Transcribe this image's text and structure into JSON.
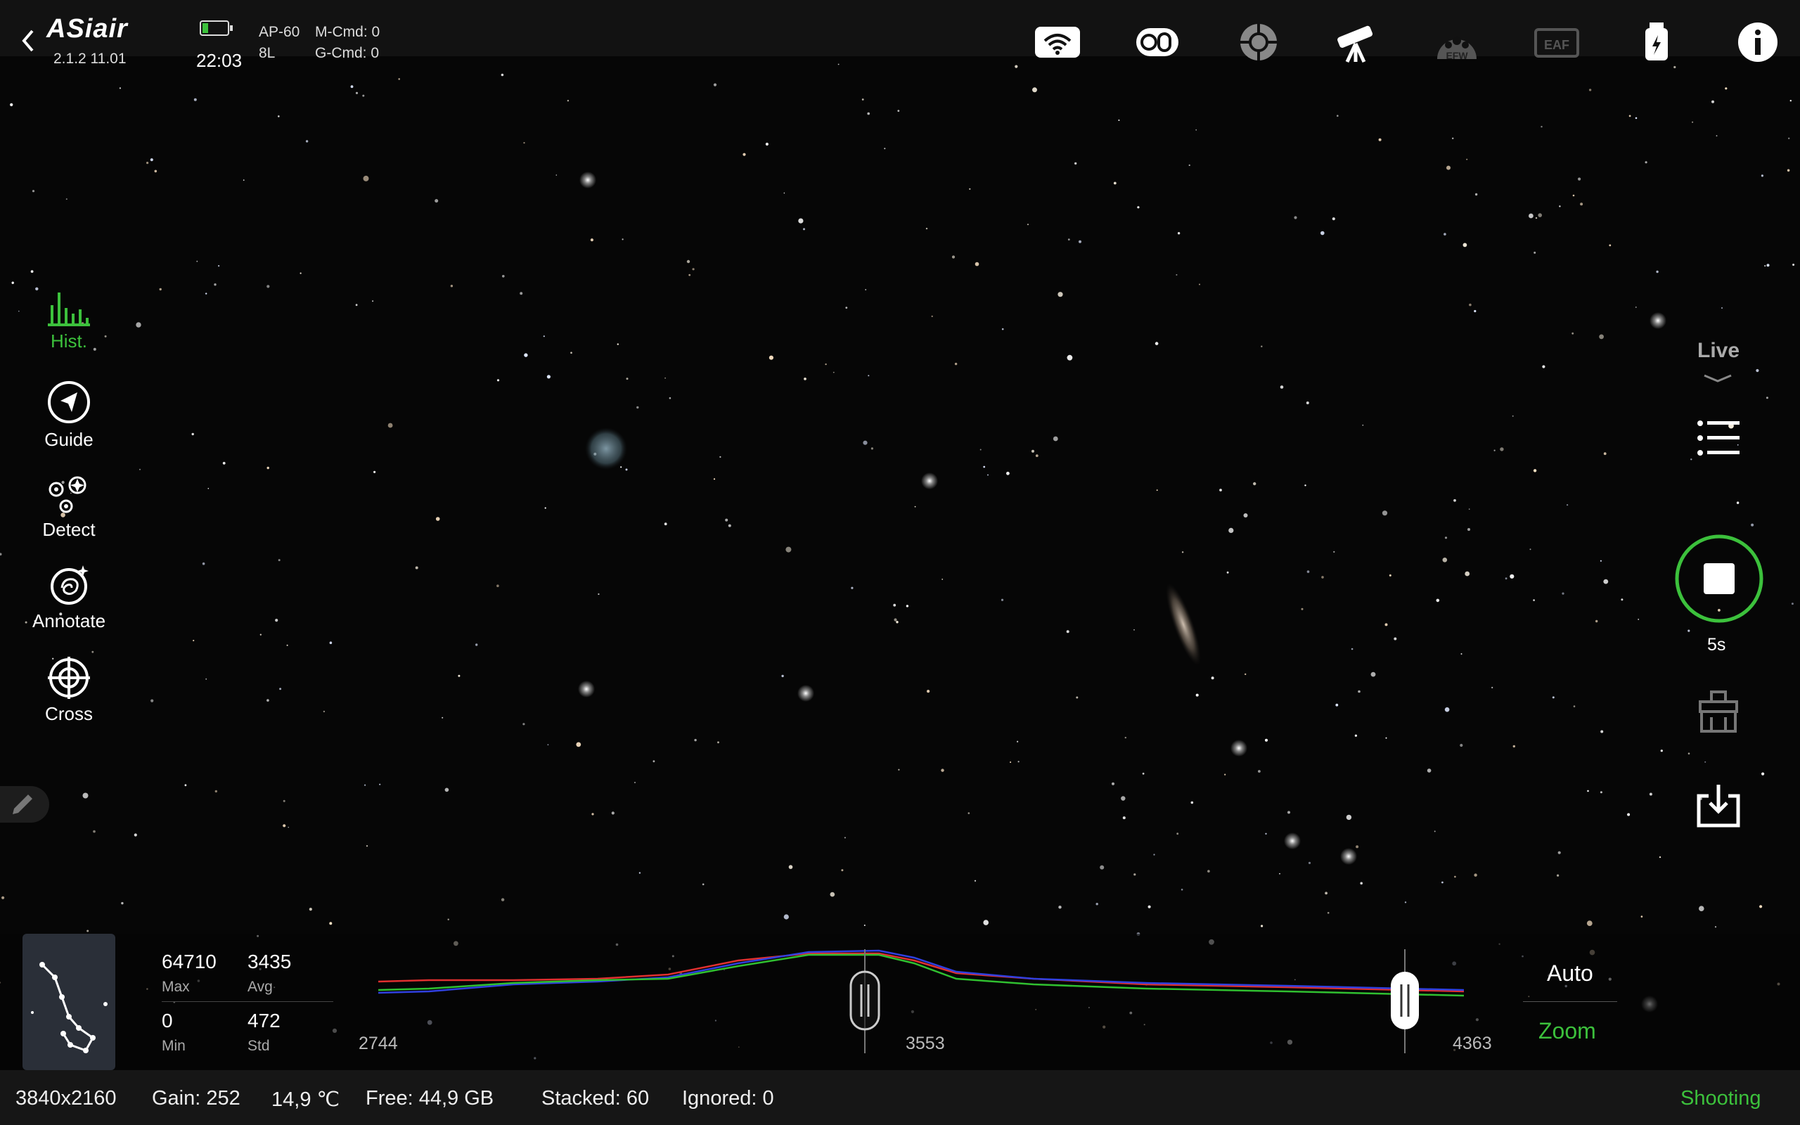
{
  "colors": {
    "accent": "#3cc13c",
    "text": "#ffffff",
    "muted": "#aaaaaa",
    "background": "#050505"
  },
  "header": {
    "app_logo": "ASiair",
    "version": "2.1.2 11.01",
    "time": "22:03",
    "device": "AP-60",
    "device_sub": "8L",
    "m_cmd": "M-Cmd: 0",
    "g_cmd": "G-Cmd: 0",
    "icons": [
      "wifi-icon",
      "filter-wheel-icon",
      "guide-target-icon",
      "telescope-icon",
      "efw-icon",
      "eaf-icon",
      "usb-power-icon",
      "info-icon"
    ],
    "efw_label": "EFW",
    "eaf_label": "EAF"
  },
  "left_nav": [
    {
      "label": "Hist.",
      "icon": "histogram-icon",
      "active": true
    },
    {
      "label": "Guide",
      "icon": "guide-icon",
      "active": false
    },
    {
      "label": "Detect",
      "icon": "detect-icon",
      "active": false
    },
    {
      "label": "Annotate",
      "icon": "annotate-icon",
      "active": false
    },
    {
      "label": "Cross",
      "icon": "crosshair-icon",
      "active": false
    }
  ],
  "right_panel": {
    "mode": "Live",
    "exposure": "5s",
    "icons": [
      "menu-icon",
      "record-stop-icon",
      "clear-icon",
      "download-icon"
    ]
  },
  "histogram": {
    "max_value": "64710",
    "max_label": "Max",
    "avg_value": "3435",
    "avg_label": "Avg",
    "min_value": "0",
    "min_label": "Min",
    "std_value": "472",
    "std_label": "Std",
    "axis_min": "2744",
    "axis_mid": "3553",
    "axis_max": "4363",
    "auto_label": "Auto",
    "zoom_label": "Zoom",
    "curve_colors": [
      "#e03030",
      "#3040e0",
      "#30c030"
    ]
  },
  "status_bar": {
    "resolution": "3840x2160",
    "gain": "Gain: 252",
    "temperature": "14,9 ℃",
    "free": "Free: 44,9 GB",
    "stacked": "Stacked: 60",
    "ignored": "Ignored: 0",
    "state": "Shooting"
  }
}
